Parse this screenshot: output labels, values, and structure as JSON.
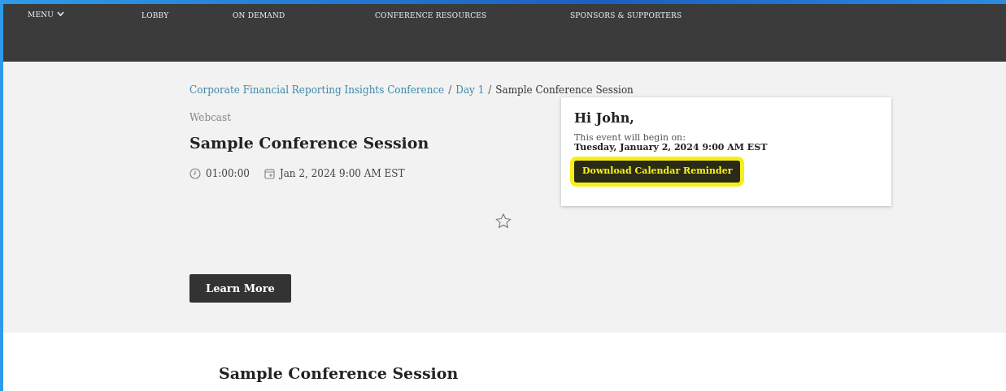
{
  "nav": {
    "menu": {
      "label": "MENU",
      "expanded": false
    },
    "items": [
      {
        "label": "LOBBY"
      },
      {
        "label": "ON DEMAND"
      },
      {
        "label": "CONFERENCE RESOURCES"
      },
      {
        "label": "SPONSORS & SUPPORTERS"
      }
    ]
  },
  "breadcrumb": [
    {
      "kind": "link",
      "label": "Corporate Financial Reporting Insights Conference"
    },
    {
      "kind": "separator",
      "label": "/"
    },
    {
      "kind": "link",
      "label": "Day 1"
    },
    {
      "kind": "separator",
      "label": "/"
    },
    {
      "kind": "current",
      "label": "Sample Conference Session"
    }
  ],
  "session": {
    "type": "Webcast",
    "title": "Sample Conference Session",
    "duration": "01:00:00",
    "date": "Jan 2, 2024 9:00 AM EST",
    "favorited": false
  },
  "reminder": {
    "greeting": "Hi John,",
    "intro": "This event will begin on:",
    "datetime": "Tuesday, January 2, 2024 9:00 AM EST",
    "button": "Download Calendar Reminder",
    "highlighted": true
  },
  "learn_more": "Learn More",
  "section_title": "Sample Conference Session"
}
